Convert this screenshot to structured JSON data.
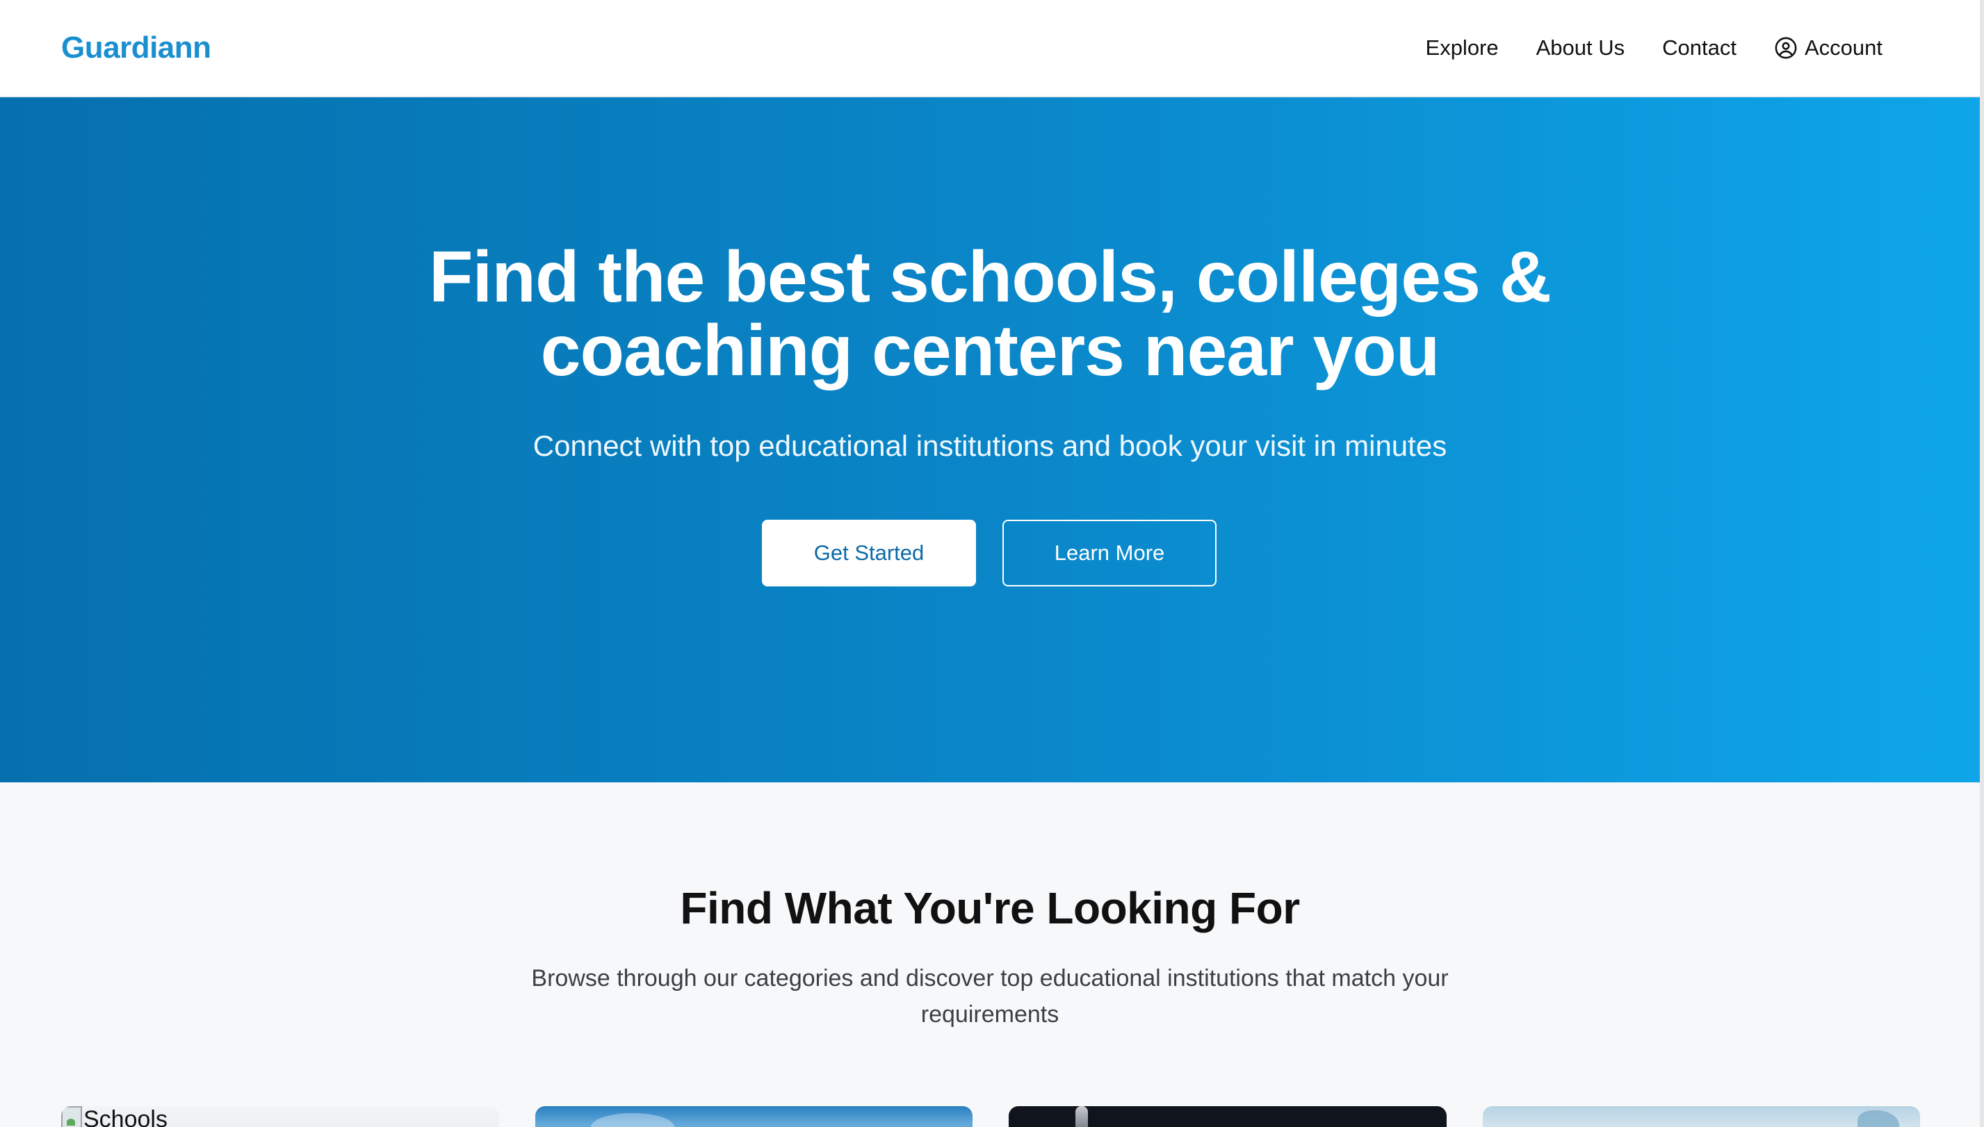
{
  "header": {
    "logo": "Guardiann",
    "nav": {
      "explore": "Explore",
      "about": "About Us",
      "contact": "Contact",
      "account": "Account"
    }
  },
  "hero": {
    "title_line1": "Find the best schools, colleges &",
    "title_line2": "coaching centers near you",
    "subtitle": "Connect with top educational institutions and book your visit in minutes",
    "primary_button": "Get Started",
    "secondary_button": "Learn More"
  },
  "categories": {
    "title": "Find What You're Looking For",
    "description": "Browse through our categories and discover top educational institutions that match your requirements",
    "cards": [
      {
        "image_alt": "Schools"
      },
      {
        "image_alt": ""
      },
      {
        "image_alt": ""
      },
      {
        "image_alt": ""
      }
    ]
  },
  "colors": {
    "brand": "#1a8fd0",
    "hero_start": "#0570ad",
    "hero_end": "#0ea5e9",
    "button_text": "#0a6aa8",
    "section_bg": "#f7f8fa"
  },
  "icons": {
    "account": "user-circle-icon"
  }
}
